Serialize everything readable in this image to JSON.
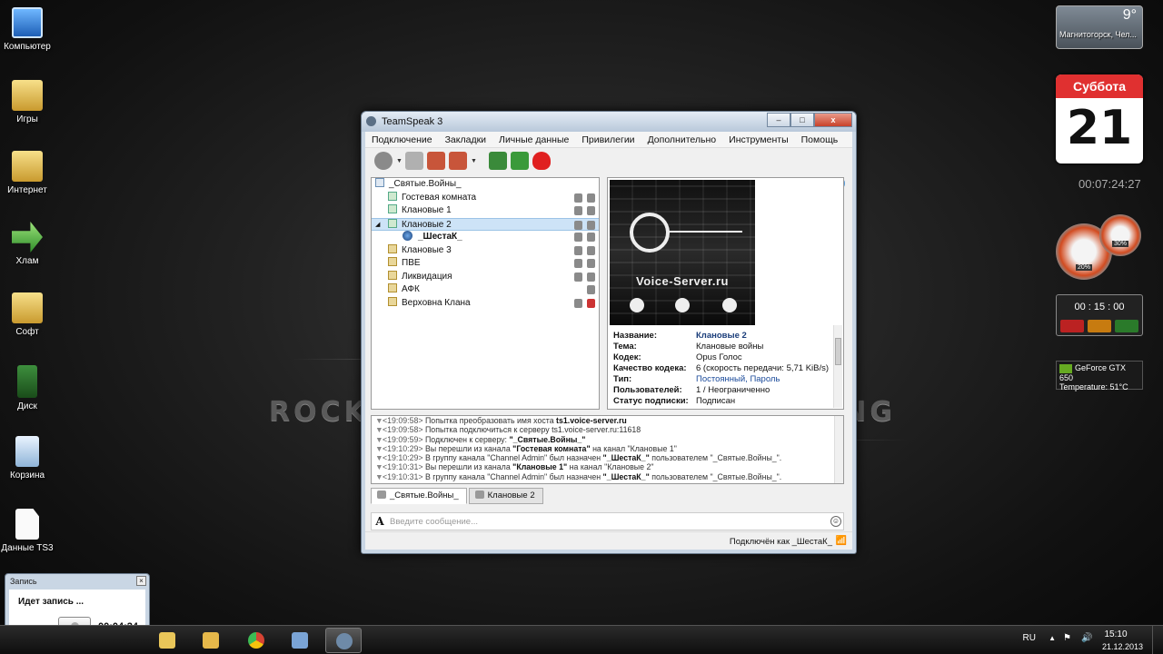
{
  "desktop": {
    "icons": [
      {
        "label": "Компьютер",
        "icon": "computer-icon"
      },
      {
        "label": "Игры",
        "icon": "folder-icon"
      },
      {
        "label": "Интернет",
        "icon": "folder-icon"
      },
      {
        "label": "Хлам",
        "icon": "arrow-icon"
      },
      {
        "label": "Софт",
        "icon": "folder-icon"
      },
      {
        "label": "Диск",
        "icon": "disk-icon"
      },
      {
        "label": "Корзина",
        "icon": "recycle-bin-icon"
      },
      {
        "label": "Данные TS3",
        "icon": "document-icon"
      }
    ],
    "wallpaper_text_left": "ROCK",
    "wallpaper_text_right": "NG"
  },
  "gadgets": {
    "weather": {
      "temp": "9°",
      "city": "Магнитогорск, Чел..."
    },
    "calendar": {
      "day_of_week": "Суббота",
      "day": "21"
    },
    "clock": "00:07:24:27",
    "meters": {
      "cpu": "20%",
      "ram": "30%"
    },
    "timer": "00 : 15 : 00",
    "gpu": {
      "name": "GeForce GTX 650",
      "temperature_label": "Temperature:",
      "temperature": "51°C"
    }
  },
  "teamspeak": {
    "title": "TeamSpeak 3",
    "window_buttons": {
      "minimize": "–",
      "maximize": "□",
      "close": "x"
    },
    "menu": [
      "Подключение",
      "Закладки",
      "Личные данные",
      "Привилегии",
      "Дополнительно",
      "Инструменты",
      "Помощь"
    ],
    "toolbar_colors": {
      "connect": "#8a8a8a",
      "bookmark": "#b0b0b0",
      "away": "#c8553a",
      "mute": "#c8553a",
      "capture": "#3a8a3a",
      "user": "#3a9a3a",
      "fire": "#e02020"
    },
    "tree": {
      "server": "_Святые.Войны_",
      "channels": [
        {
          "name": "Гостевая комната",
          "locked": false,
          "flags": 2,
          "red": false
        },
        {
          "name": "Клановые 1",
          "locked": false,
          "flags": 2,
          "red": false
        },
        {
          "name": "Клановые 2",
          "locked": false,
          "flags": 2,
          "red": false,
          "selected": true
        },
        {
          "name": "_ШестаК_",
          "user": true,
          "flags": 2,
          "red": false
        },
        {
          "name": "Клановые 3",
          "locked": true,
          "flags": 2,
          "red": false
        },
        {
          "name": "ПВЕ",
          "locked": true,
          "flags": 2,
          "red": false
        },
        {
          "name": "Ликвидация",
          "locked": true,
          "flags": 2,
          "red": false
        },
        {
          "name": "АФК",
          "locked": true,
          "flags": 1,
          "red": false
        },
        {
          "name": "Верховна Клана",
          "locked": true,
          "flags": 2,
          "red": true
        }
      ]
    },
    "banner_text": "Voice-Server.ru",
    "info": [
      {
        "key": "Название:",
        "value": "Клановые 2",
        "style": "title"
      },
      {
        "key": "Тема:",
        "value": "Клановые войны",
        "style": ""
      },
      {
        "key": "Кодек:",
        "value": "Opus Голос",
        "style": ""
      },
      {
        "key": "Качество кодека:",
        "value": "6 (скорость передачи: 5,71 KiB/s)",
        "style": ""
      },
      {
        "key": "Тип:",
        "value": "Постоянный, Пароль",
        "style": "link"
      },
      {
        "key": "Пользователей:",
        "value": "1 / Неограниченно",
        "style": ""
      },
      {
        "key": "Статус подписки:",
        "value": "Подписан",
        "style": ""
      }
    ],
    "log": [
      {
        "time": "<19:09:58>",
        "text": "Попытка преобразовать имя хоста ",
        "bold": "ts1.voice-server.ru",
        "rest": ""
      },
      {
        "time": "<19:09:58>",
        "text": "Попытка подключиться к серверу ts1.voice-server.ru:11618",
        "bold": "",
        "rest": ""
      },
      {
        "time": "<19:09:59>",
        "text": "Подключен к серверу: ",
        "bold": "\"_Святые.Войны_\"",
        "rest": ""
      },
      {
        "time": "<19:10:29>",
        "text": "Вы перешли из канала ",
        "bold": "\"Гостевая комната\"",
        "rest": " на канал \"Клановые 1\""
      },
      {
        "time": "<19:10:29>",
        "text": "В группу канала \"Channel Admin\" был назначен ",
        "bold": "\"_ШестаК_\"",
        "rest": " пользователем \"_Святые.Войны_\"."
      },
      {
        "time": "<19:10:31>",
        "text": "Вы перешли из канала ",
        "bold": "\"Клановые 1\"",
        "rest": " на канал \"Клановые 2\""
      },
      {
        "time": "<19:10:31>",
        "text": "В группу канала \"Channel Admin\" был назначен ",
        "bold": "\"_ШестаК_\"",
        "rest": " пользователем \"_Святые.Войны_\"."
      }
    ],
    "tabs": [
      "_Святые.Войны_",
      "Клановые 2"
    ],
    "message_placeholder": "Введите сообщение...",
    "status_text": "Подключён как _ШестаК_"
  },
  "recorder": {
    "title": "Запись",
    "status": "Идет запись ...",
    "elapsed": "00:04:24"
  },
  "taskbar": {
    "items": [
      {
        "icon": "folder-pin-icon",
        "color": "#e9c659"
      },
      {
        "icon": "explorer-icon",
        "color": "#e6b84a"
      },
      {
        "icon": "chrome-icon",
        "color": "#d64333"
      },
      {
        "icon": "app-window-icon",
        "color": "#7aa4d6"
      },
      {
        "icon": "teamspeak-icon",
        "color": "#6e8aa8",
        "active": true
      }
    ],
    "lang": "RU",
    "time": "15:10",
    "date": "21.12.2013"
  }
}
